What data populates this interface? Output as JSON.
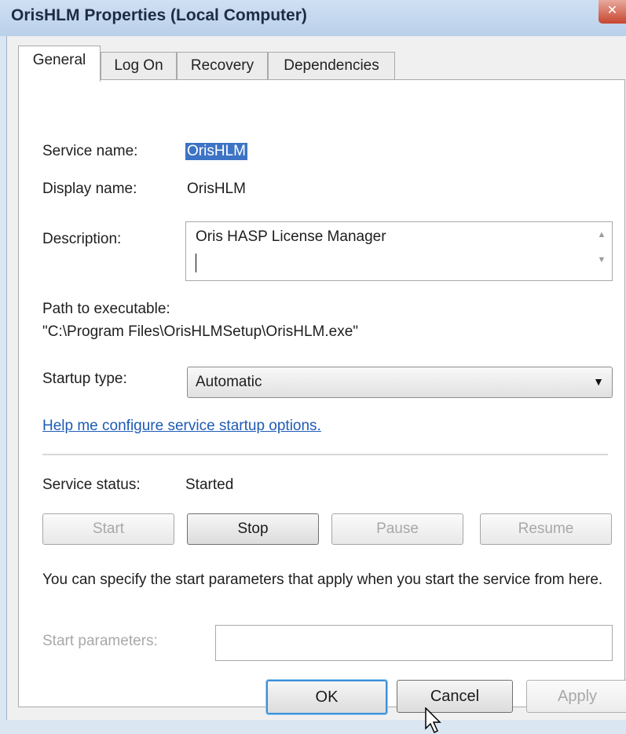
{
  "window": {
    "title": "OrisHLM Properties (Local Computer)",
    "close_glyph": "✕"
  },
  "tabs": [
    {
      "label": "General",
      "active": true
    },
    {
      "label": "Log On",
      "active": false
    },
    {
      "label": "Recovery",
      "active": false
    },
    {
      "label": "Dependencies",
      "active": false
    }
  ],
  "general": {
    "service_name_label": "Service name:",
    "service_name_value": "OrisHLM",
    "display_name_label": "Display name:",
    "display_name_value": "OrisHLM",
    "description_label": "Description:",
    "description_value": "Oris HASP License Manager",
    "path_label": "Path to executable:",
    "path_value": "\"C:\\Program Files\\OrisHLMSetup\\OrisHLM.exe\"",
    "startup_type_label": "Startup type:",
    "startup_type_value": "Automatic",
    "help_link": "Help me configure service startup options.",
    "service_status_label": "Service status:",
    "service_status_value": "Started",
    "buttons": {
      "start": "Start",
      "stop": "Stop",
      "pause": "Pause",
      "resume": "Resume"
    },
    "start_params_note": "You can specify the start parameters that apply when you start the service from here.",
    "start_params_label": "Start parameters:",
    "start_params_value": ""
  },
  "footer": {
    "ok": "OK",
    "cancel": "Cancel",
    "apply": "Apply"
  }
}
